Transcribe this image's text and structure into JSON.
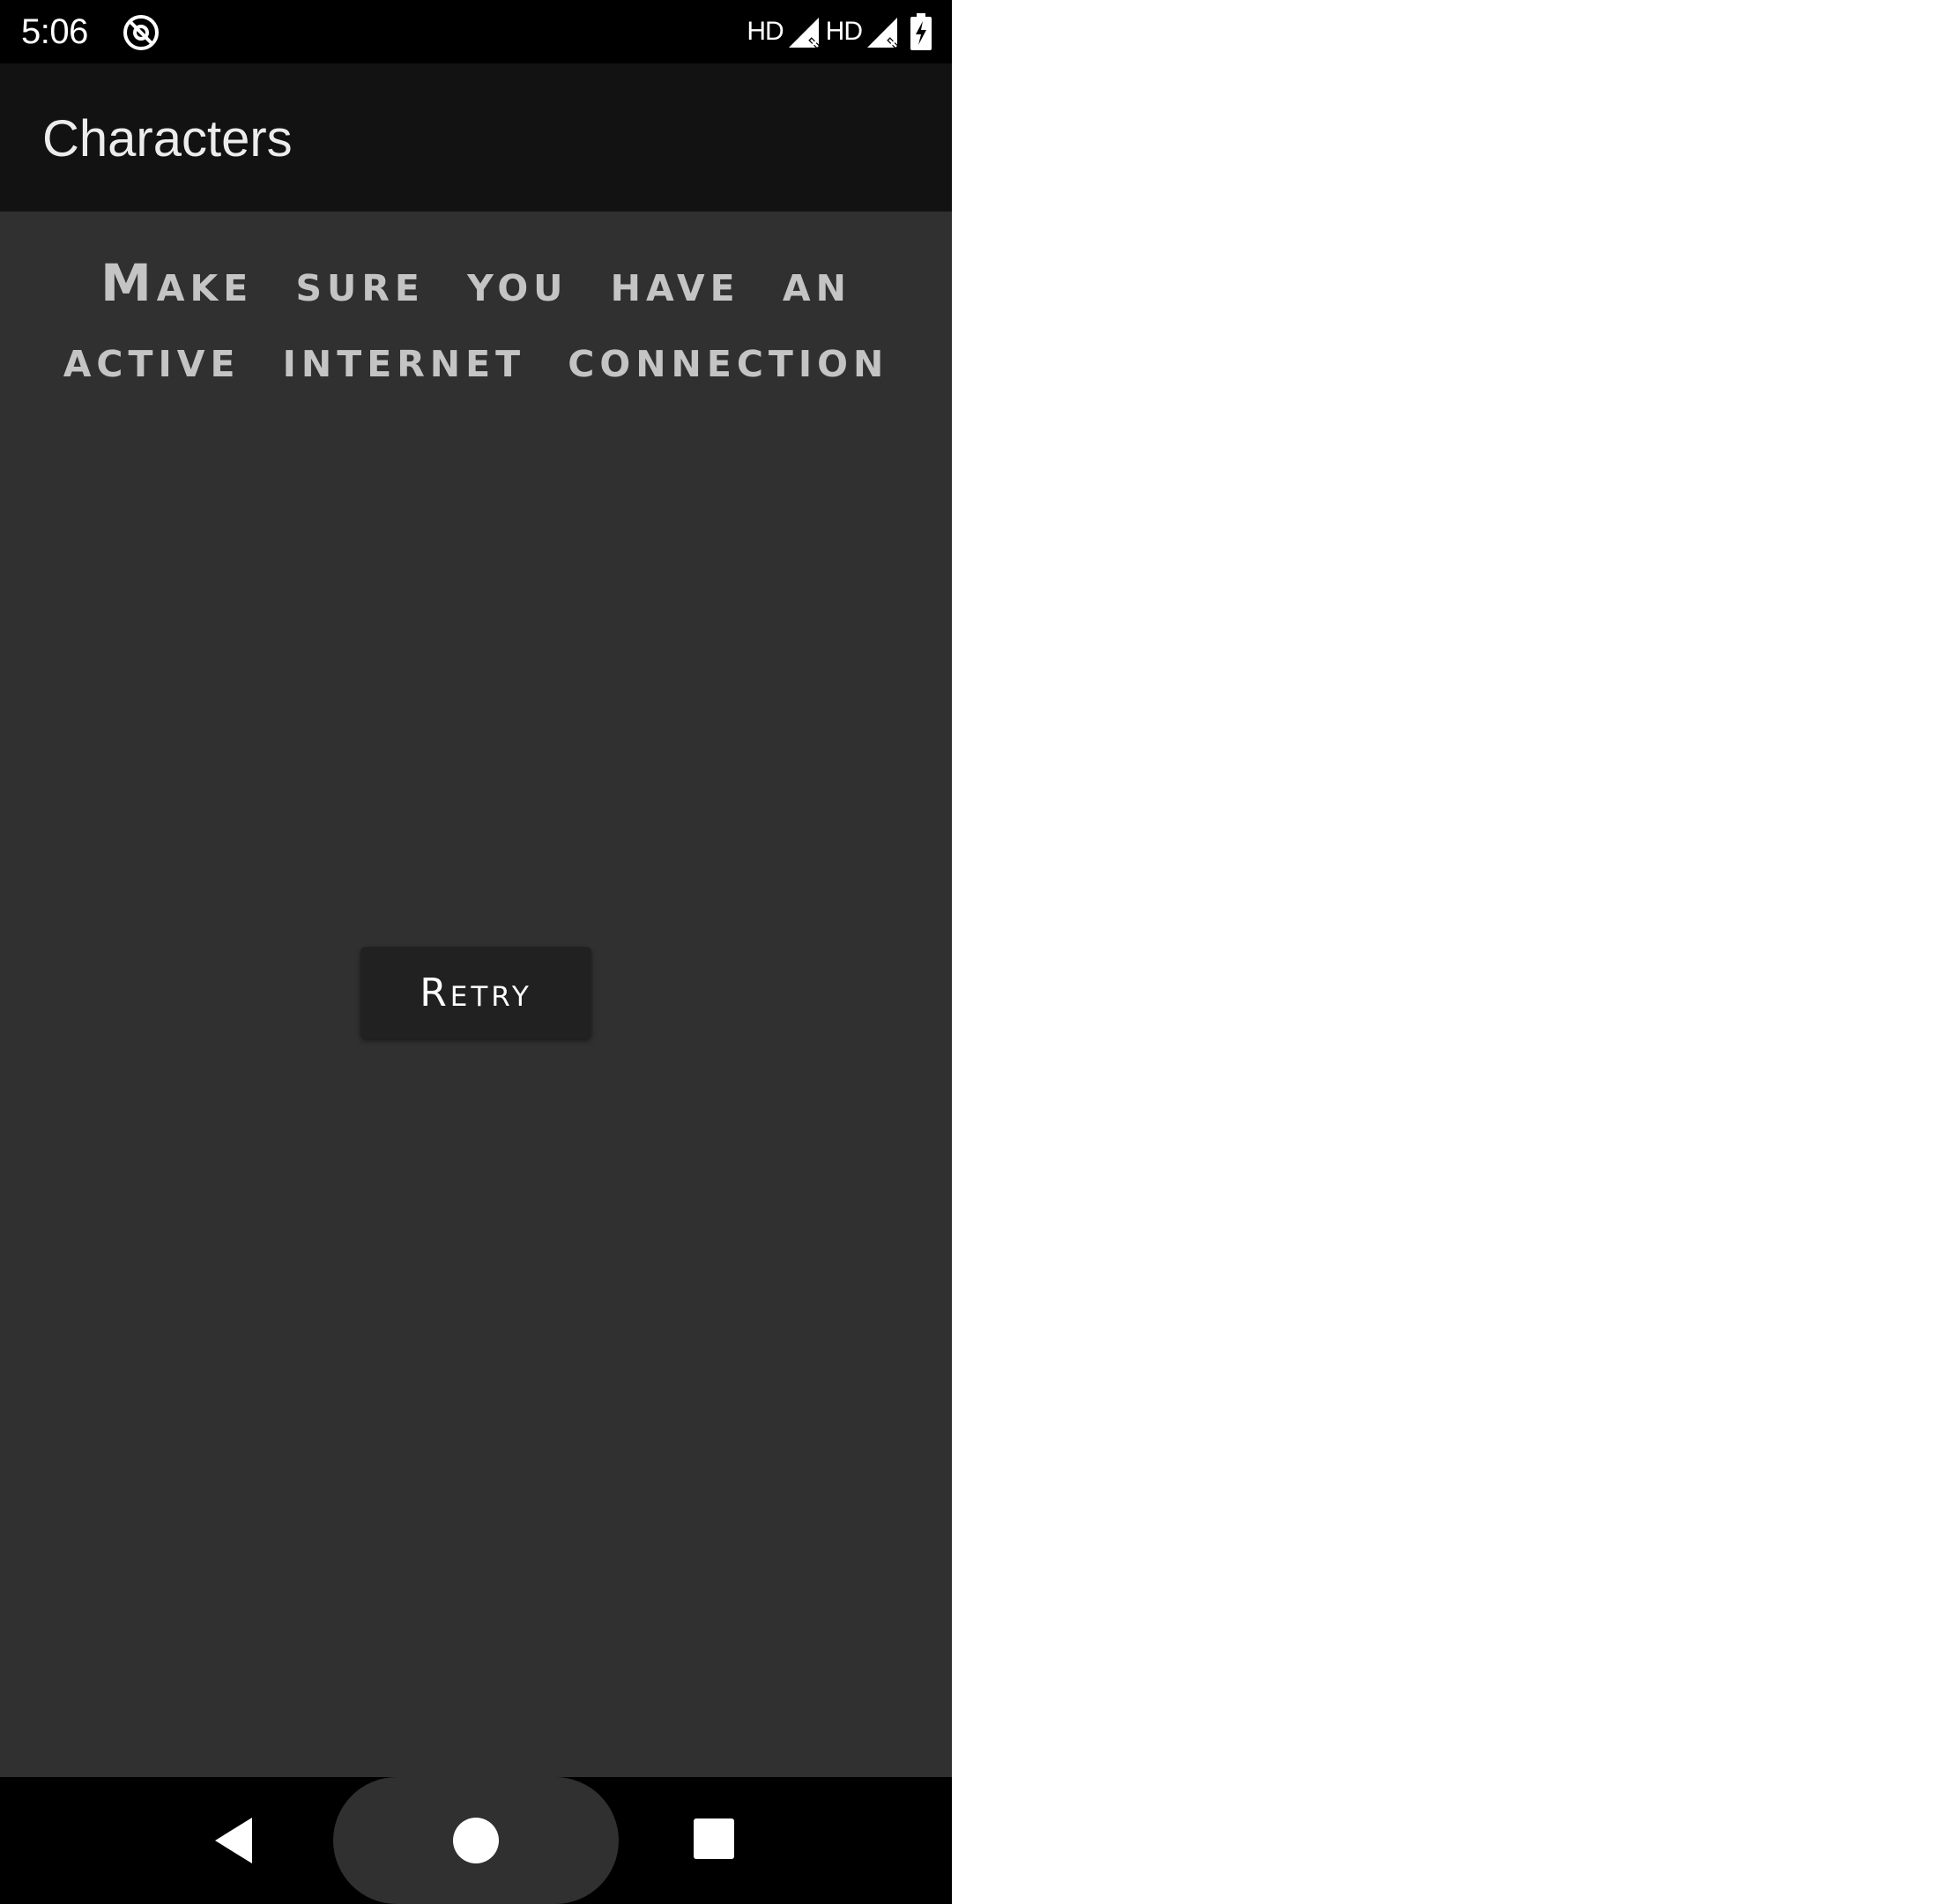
{
  "status_bar": {
    "time": "5:06",
    "app_icon": "at-sign-notification-icon",
    "network_1_label": "HD",
    "network_2_label": "HD",
    "signal_icon": "signal-no-service-icon",
    "battery_icon": "battery-charging-icon"
  },
  "app_bar": {
    "title": "Characters"
  },
  "content": {
    "message": "Make sure you have an active internet connection",
    "retry_label": "Retry"
  },
  "nav_bar": {
    "back_icon": "back-triangle-icon",
    "home_icon": "home-circle-icon",
    "recents_icon": "recents-square-icon"
  },
  "colors": {
    "status_bar_bg": "#000000",
    "app_bar_bg": "#121212",
    "content_bg": "#303030",
    "button_bg": "#212121",
    "message_text": "#c4c4c4"
  }
}
